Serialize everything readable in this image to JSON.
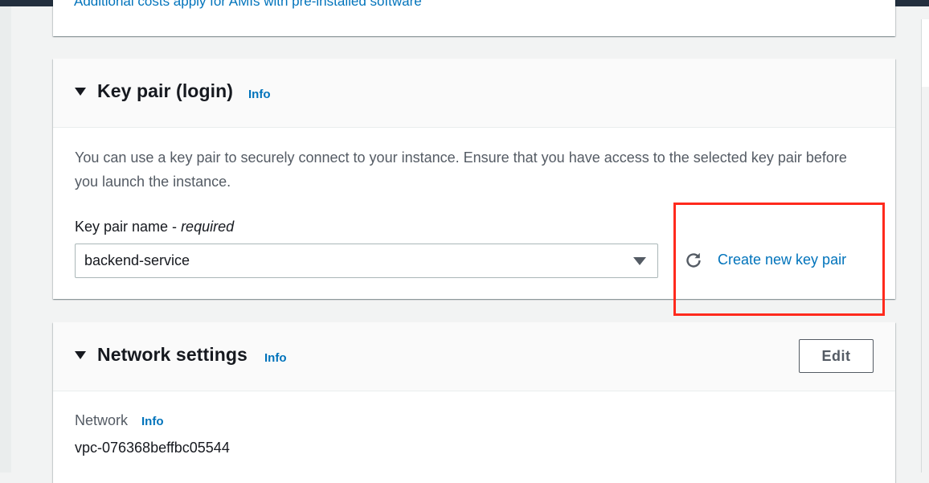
{
  "top_section": {
    "cut_text": "Additional costs apply for AMIs with pre-installed software"
  },
  "key_pair_section": {
    "title": "Key pair (login)",
    "info": "Info",
    "description": "You can use a key pair to securely connect to your instance. Ensure that you have access to the selected key pair before you launch the instance.",
    "field_label": "Key pair name - ",
    "field_required": "required",
    "selected_value": "backend-service",
    "create_link": "Create new key pair",
    "refresh_icon": "refresh-icon",
    "dropdown_icon": "caret-down-icon",
    "highlight_color": "#ff2a1d"
  },
  "network_section": {
    "title": "Network settings",
    "info": "Info",
    "edit_label": "Edit",
    "network_label": "Network",
    "network_info": "Info",
    "network_value": "vpc-076368beffbc05544"
  },
  "colors": {
    "link": "#0073bb",
    "text": "#16191f",
    "muted": "#545b64",
    "background": "#f2f3f3",
    "header_bg": "#fafafa"
  }
}
